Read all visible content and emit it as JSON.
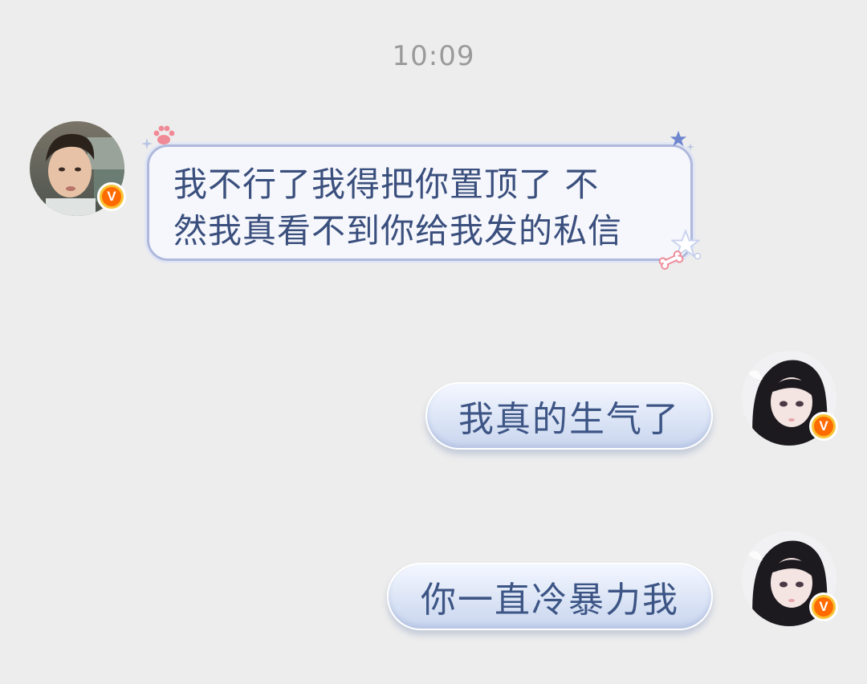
{
  "chat": {
    "timestamp": "10:09",
    "messages": [
      {
        "side": "incoming",
        "lines": [
          "我不行了我得把你置顶了 不",
          "然我真看不到你给我发的私信"
        ]
      },
      {
        "side": "outgoing",
        "text": "我真的生气了"
      },
      {
        "side": "outgoing",
        "text": "你一直冷暴力我"
      }
    ]
  },
  "badges": {
    "verified_label": "V"
  },
  "colors": {
    "background": "#ededed",
    "bubble_text": "#3a4f7d",
    "badge_outer": "#f7c234",
    "badge_inner": "#ff6b00"
  }
}
